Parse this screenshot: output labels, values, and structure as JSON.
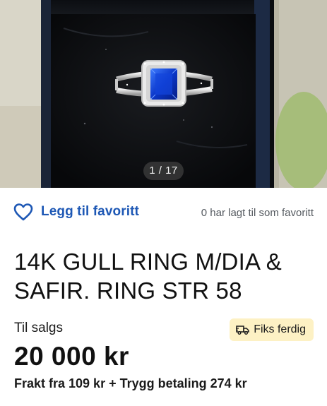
{
  "gallery": {
    "counter": "1 / 17",
    "image_icon": "ring-photo"
  },
  "favorite": {
    "label": "Legg til favoritt",
    "icon": "heart-outline-icon",
    "count_text": "0 har lagt til som favoritt",
    "color": "#1e58b5"
  },
  "listing": {
    "title": "14K GULL RING M/DIA & SAFIR. RING STR 58",
    "status": "Til salgs",
    "badge_label": "Fiks ferdig",
    "badge_icon": "delivery-truck-icon",
    "badge_color": "#fdf1c4",
    "price": "20 000 kr",
    "shipping": "Frakt fra 109 kr + Trygg betaling 274 kr"
  }
}
